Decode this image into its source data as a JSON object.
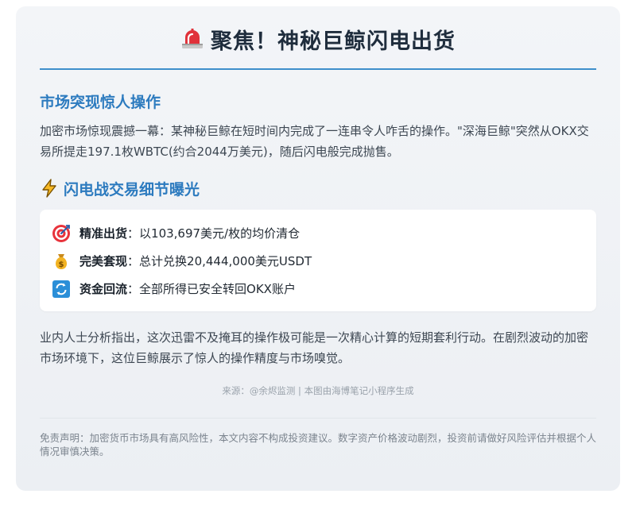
{
  "header": {
    "title": "聚焦！神秘巨鲸闪电出货",
    "icon": "siren-icon"
  },
  "section1": {
    "heading": "市场突现惊人操作",
    "paragraph": "加密市场惊现震撼一幕：某神秘巨鲸在短时间内完成了一连串令人咋舌的操作。\"深海巨鲸\"突然从OKX交易所提走197.1枚WBTC(约合2044万美元)，随后闪电般完成抛售。"
  },
  "section2": {
    "heading": "闪电战交易细节曝光",
    "icon": "lightning-icon",
    "items": [
      {
        "icon": "target-icon",
        "label": "精准出货",
        "sep": "：",
        "text": "以103,697美元/枚的均价清仓"
      },
      {
        "icon": "money-bag-icon",
        "label": "完美套现",
        "sep": "：",
        "text": "总计兑换20,444,000美元USDT"
      },
      {
        "icon": "refresh-icon",
        "label": "资金回流",
        "sep": "：",
        "text": "全部所得已安全转回OKX账户"
      }
    ]
  },
  "analysis": "业内人士分析指出，这次迅雷不及掩耳的操作极可能是一次精心计算的短期套利行动。在剧烈波动的加密市场环境下，这位巨鲸展示了惊人的操作精度与市场嗅觉。",
  "source": "来源：@余烬监测 | 本图由海博笔记小程序生成",
  "disclaimer": "免责声明：加密货币市场具有高风险性，本文内容不构成投资建议。数字资产价格波动剧烈，投资前请做好风险评估并根据个人情况审慎决策。",
  "colors": {
    "accent": "#2d7bbf",
    "rule": "#3f8fcb",
    "title": "#1f2d3d",
    "body": "#3d4752"
  }
}
